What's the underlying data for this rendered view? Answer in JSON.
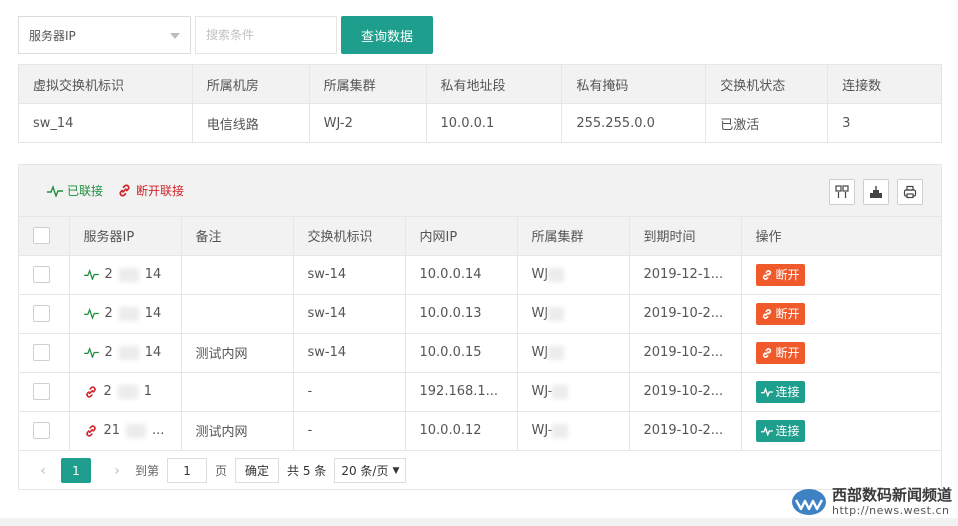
{
  "search": {
    "select_value": "服务器IP",
    "placeholder": "搜索条件",
    "button_label": "查询数据"
  },
  "switch_info": {
    "headers": [
      "虚拟交换机标识",
      "所属机房",
      "所属集群",
      "私有地址段",
      "私有掩码",
      "交换机状态",
      "连接数"
    ],
    "values": [
      "sw_14",
      "电信线路",
      "WJ-2",
      "10.0.0.1",
      "255.255.0.0",
      "已激活",
      "3"
    ]
  },
  "toolbar": {
    "connected_label": "已联接",
    "disconnect_label": "断开联接"
  },
  "servers": {
    "headers": [
      "服务器IP",
      "备注",
      "交换机标识",
      "内网IP",
      "所属集群",
      "到期时间",
      "操作"
    ],
    "rows": [
      {
        "status": "connected",
        "ip": "2",
        "ip_tail": "14",
        "note": "",
        "switch": "sw-14",
        "lan_ip": "10.0.0.14",
        "cluster": "WJ",
        "expire": "2019-12-1...",
        "action": "断开"
      },
      {
        "status": "connected",
        "ip": "2",
        "ip_tail": "14",
        "note": "",
        "switch": "sw-14",
        "lan_ip": "10.0.0.13",
        "cluster": "WJ",
        "expire": "2019-10-2...",
        "action": "断开"
      },
      {
        "status": "connected",
        "ip": "2",
        "ip_tail": "14",
        "note": "测试内网",
        "switch": "sw-14",
        "lan_ip": "10.0.0.15",
        "cluster": "WJ",
        "expire": "2019-10-2...",
        "action": "断开"
      },
      {
        "status": "disconnected",
        "ip": "2",
        "ip_tail": "1",
        "note": "",
        "switch": "-",
        "lan_ip": "192.168.1...",
        "cluster": "WJ-",
        "expire": "2019-10-2...",
        "action": "连接"
      },
      {
        "status": "disconnected",
        "ip": "21",
        "ip_tail": "...",
        "note": "测试内网",
        "switch": "-",
        "lan_ip": "10.0.0.12",
        "cluster": "WJ-",
        "expire": "2019-10-2...",
        "action": "连接"
      }
    ]
  },
  "pager": {
    "current_page": "1",
    "goto_prefix": "到第",
    "goto_value": "1",
    "goto_suffix": "页",
    "confirm_label": "确定",
    "total": "共 5 条",
    "page_size": "20 条/页"
  },
  "watermark": {
    "title": "西部数码新闻频道",
    "url": "http://news.west.cn"
  },
  "colors": {
    "accent": "#1e9e8c",
    "disconnect_button": "#f05a2b",
    "connected_text": "#1e8e3e",
    "disconnected_text": "#d0232b"
  }
}
